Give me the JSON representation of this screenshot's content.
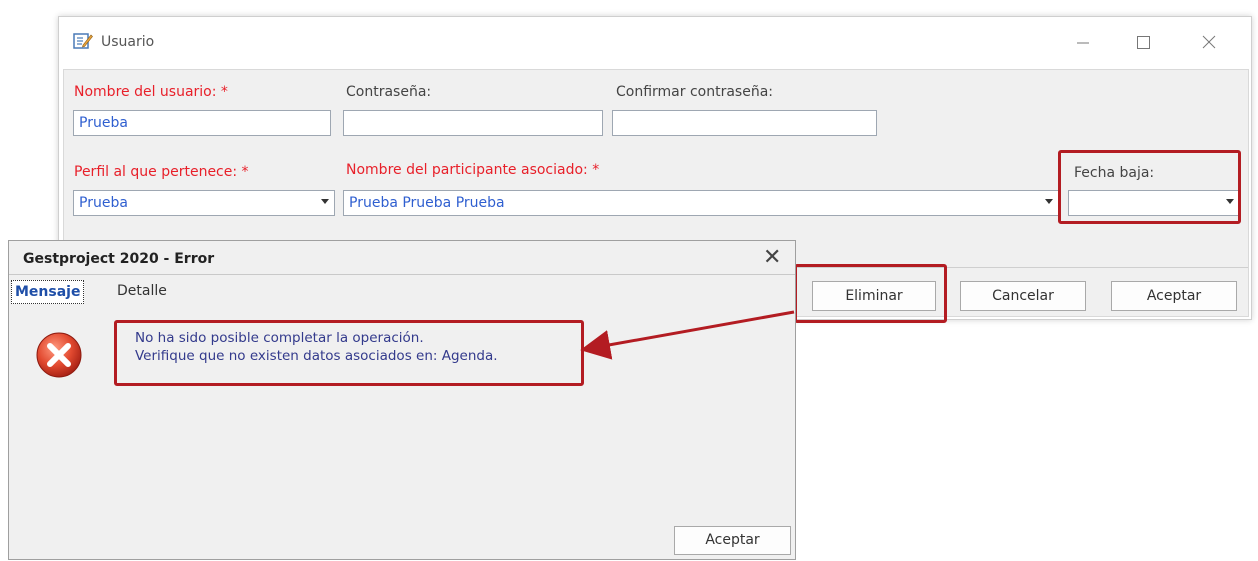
{
  "usuario_window": {
    "title": "Usuario",
    "fields": {
      "nombre_usuario": {
        "label": "Nombre del usuario: *",
        "value": "Prueba"
      },
      "contrasena": {
        "label": "Contraseña:",
        "value": ""
      },
      "confirmar_contrasena": {
        "label": "Confirmar contraseña:",
        "value": ""
      },
      "perfil": {
        "label": "Perfil al que pertenece: *",
        "value": "Prueba"
      },
      "participante": {
        "label": "Nombre del participante asociado: *",
        "value": "Prueba Prueba Prueba"
      },
      "fecha_baja": {
        "label": "Fecha baja:",
        "value": ""
      }
    },
    "buttons": {
      "eliminar": "Eliminar",
      "cancelar": "Cancelar",
      "aceptar": "Aceptar"
    }
  },
  "error_dialog": {
    "title": "Gestproject 2020 - Error",
    "close_glyph": "✕",
    "tabs": [
      "Mensaje",
      "Detalle"
    ],
    "active_tab": "Mensaje",
    "message_line_1": "No ha sido posible completar la operación.",
    "message_line_2": "Verifique que no existen datos asociados en: Agenda.",
    "ok_button": "Aceptar"
  },
  "colors": {
    "required_label": "#e8202a",
    "field_text": "#2f5fd0",
    "highlight": "#b31c22",
    "message_text": "#333a8c",
    "error_icon": "#d83a2a"
  },
  "icons": {
    "app": "edit-form-icon",
    "error": "error-x-icon",
    "minimize": "minimize-icon",
    "maximize": "maximize-icon",
    "close": "close-icon"
  }
}
